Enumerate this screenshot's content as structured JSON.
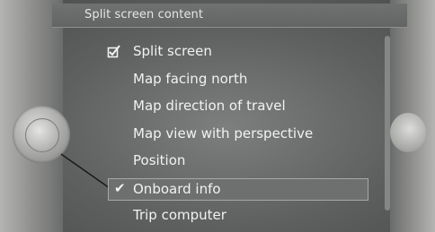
{
  "header": {
    "title": "Split screen content"
  },
  "menu": {
    "items": [
      {
        "label": "Split screen",
        "state": "checkbox-checked"
      },
      {
        "label": "Map facing north",
        "state": "none"
      },
      {
        "label": "Map direction of travel",
        "state": "none"
      },
      {
        "label": "Map view with perspective",
        "state": "none"
      },
      {
        "label": "Position",
        "state": "none"
      },
      {
        "label": "Onboard info",
        "state": "selected-checked"
      },
      {
        "label": "Trip computer",
        "state": "none"
      }
    ],
    "selected_index": 5
  },
  "icons": {
    "checkbox": "checkbox-checked-icon",
    "checkmark": "checkmark-icon",
    "controller": "controller-knob-icon"
  },
  "colors": {
    "screen_bg": "#5d605f",
    "text": "#f2f2f0",
    "selection_border": "#a7a9a8"
  }
}
